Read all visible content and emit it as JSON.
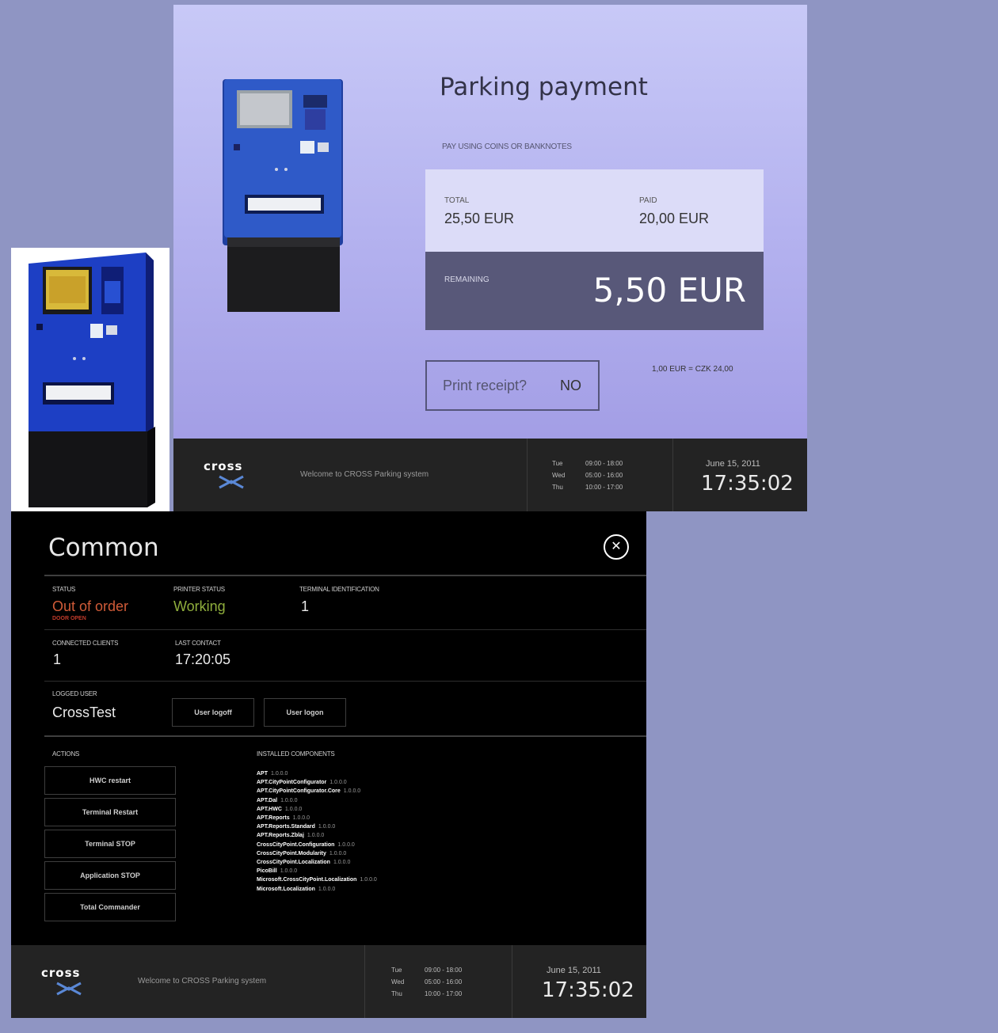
{
  "payment": {
    "title": "Parking payment",
    "subtitle": "PAY USING COINS OR BANKNOTES",
    "total_label": "TOTAL",
    "total_value": "25,50 EUR",
    "paid_label": "PAID",
    "paid_value": "20,00 EUR",
    "remaining_label": "REMAINING",
    "remaining_value": "5,50 EUR",
    "print_label": "Print receipt?",
    "print_value": "NO",
    "rate": "1,00 EUR = CZK 24,00"
  },
  "footer": {
    "logo": "cross",
    "welcome": "Welcome to CROSS Parking system",
    "hours": [
      {
        "day": "Tue",
        "hours": "09:00 - 18:00"
      },
      {
        "day": "Wed",
        "hours": "05:00 - 16:00"
      },
      {
        "day": "Thu",
        "hours": "10:00 - 17:00"
      }
    ],
    "date": "June 15, 2011",
    "time": "17:35:02"
  },
  "common": {
    "title": "Common",
    "close_icon": "close-icon",
    "status_label": "STATUS",
    "status_value": "Out of order",
    "status_detail": "DOOR OPEN",
    "printer_label": "PRINTER STATUS",
    "printer_value": "Working",
    "terminal_label": "TERMINAL IDENTIFICATION",
    "terminal_value": "1",
    "clients_label": "CONNECTED CLIENTS",
    "clients_value": "1",
    "last_contact_label": "LAST CONTACT",
    "last_contact_value": "17:20:05",
    "user_label": "LOGGED USER",
    "user_value": "CrossTest",
    "logoff_button": "User logoff",
    "logon_button": "User logon",
    "actions_label": "ACTIONS",
    "actions": [
      "HWC restart",
      "Terminal Restart",
      "Terminal STOP",
      "Application STOP",
      "Total Commander"
    ],
    "components_label": "INSTALLED COMPONENTS",
    "components": [
      {
        "name": "APT",
        "version": "1.0.0.0"
      },
      {
        "name": "APT.CityPointConfigurator",
        "version": "1.0.0.0"
      },
      {
        "name": "APT.CityPointConfigurator.Core",
        "version": "1.0.0.0"
      },
      {
        "name": "APT.Dal",
        "version": "1.0.0.0"
      },
      {
        "name": "APT.HWC",
        "version": "1.0.0.0"
      },
      {
        "name": "APT.Reports",
        "version": "1.0.0.0"
      },
      {
        "name": "APT.Reports.Standard",
        "version": "1.0.0.0"
      },
      {
        "name": "APT.Reports.Zblaj",
        "version": "1.0.0.0"
      },
      {
        "name": "CrossCityPoint.Configuration",
        "version": "1.0.0.0"
      },
      {
        "name": "CrossCityPoint.Modularity",
        "version": "1.0.0.0"
      },
      {
        "name": "CrossCityPoint.Localization",
        "version": "1.0.0.0"
      },
      {
        "name": "PicoBill",
        "version": "1.0.0.0"
      },
      {
        "name": "Microsoft.CrossCityPoint.Localization",
        "version": "1.0.0.0"
      },
      {
        "name": "Microsoft.Localization",
        "version": "1.0.0.0"
      }
    ]
  },
  "colors": {
    "background": "#8f95c3",
    "remaining_bg": "#585879",
    "status_red": "#d05b38",
    "status_green": "#8fae3c",
    "kiosk_blue": "#1f49b8"
  }
}
